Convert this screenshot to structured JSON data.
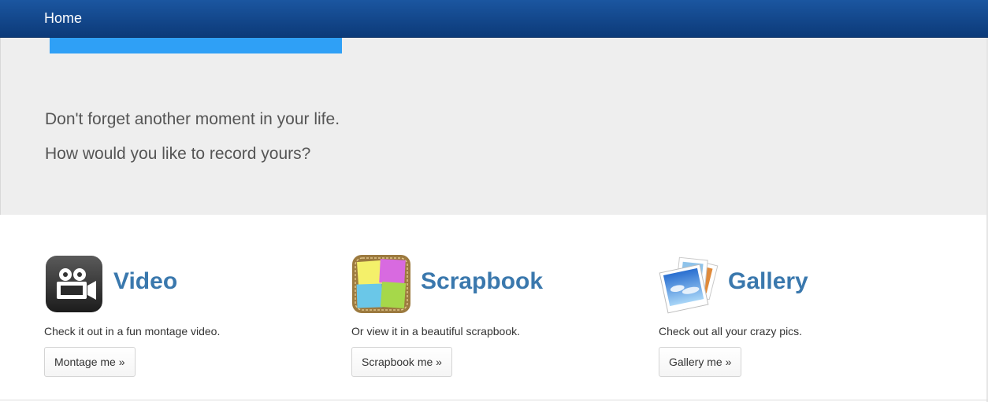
{
  "navbar": {
    "brand": "Home"
  },
  "hero": {
    "line1": "Don't forget another moment in your life.",
    "line2": "How would you like to record yours?",
    "accent_color": "#2fa0f6"
  },
  "features": [
    {
      "title": "Video",
      "description": "Check it out in a fun montage video.",
      "button": "Montage me »",
      "icon": "video-camera-icon"
    },
    {
      "title": "Scrapbook",
      "description": "Or view it in a beautiful scrapbook.",
      "button": "Scrapbook me »",
      "icon": "scrapbook-icon"
    },
    {
      "title": "Gallery",
      "description": "Check out all your crazy pics.",
      "button": "Gallery me »",
      "icon": "photo-gallery-icon"
    }
  ],
  "colors": {
    "navbar": "#0c3a79",
    "heading_link": "#3a78ad",
    "hero_background": "#eeeeee"
  }
}
